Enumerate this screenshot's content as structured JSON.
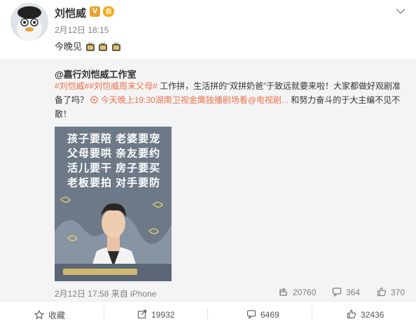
{
  "post": {
    "author": "刘恺威",
    "verified_mark": "V",
    "vip_mark": "会",
    "time": "2月12日 18:15",
    "text": "今晚见"
  },
  "repost": {
    "author": "@嘉行刘恺威工作室",
    "hashtags": [
      "#刘恺威#",
      "#刘恺威周末父母#"
    ],
    "text_1": "工作拼，生活拼的“双拼奶爸”于致远就要来啦！大家都做好观剧准备了吗？",
    "link": "今天晚上19:30湖南卫视金鹰独播剧场看@电视剧...",
    "text_2": "和努力奋斗的于大主编不见不散！",
    "poster_lines": [
      "孩子要陪  老婆要宠",
      "父母要哄  亲友要约",
      "活儿要干  房子要买",
      "老板要拍  对手要防"
    ],
    "meta": "2月12日 17:58 来自 iPhone",
    "stats": {
      "reposts": "20760",
      "comments": "364",
      "likes": "370"
    }
  },
  "actions": {
    "favorite": "收藏",
    "repost": "19932",
    "comment": "6469",
    "like": "32436"
  },
  "colors": {
    "accent": "#eb7350",
    "repost_bg": "#f4f4f4",
    "verified": "#e8a331"
  }
}
